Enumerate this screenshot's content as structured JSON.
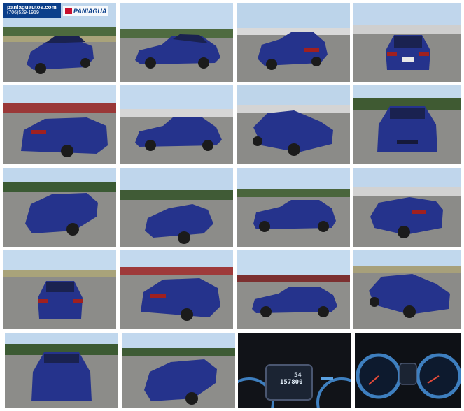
{
  "overlay": {
    "site": "paniaguautos.com",
    "phone": "(706)529-1919",
    "brand": "PANIAGUA"
  },
  "colors": {
    "car_body": "#25338c",
    "sky": "#bfd6ec",
    "lot": "#8a8a88",
    "grass": "#a9a37a",
    "dash": "#111318",
    "gauge_ring": "#3e7fbf"
  },
  "odometer": {
    "top": "54",
    "miles": "157800"
  },
  "tiles": [
    {
      "view": "front-left"
    },
    {
      "view": "left"
    },
    {
      "view": "rear-left"
    },
    {
      "view": "rear"
    },
    {
      "view": "rear-left-far"
    },
    {
      "view": "left"
    },
    {
      "view": "front-left"
    },
    {
      "view": "front"
    },
    {
      "view": "front-left"
    },
    {
      "view": "front-left"
    },
    {
      "view": "left"
    },
    {
      "view": "rear-left"
    },
    {
      "view": "rear"
    },
    {
      "view": "rear-left"
    },
    {
      "view": "left"
    },
    {
      "view": "front-left"
    },
    {
      "view": "front"
    },
    {
      "view": "front-left"
    },
    {
      "view": "cluster"
    },
    {
      "view": "cluster-wide"
    }
  ]
}
